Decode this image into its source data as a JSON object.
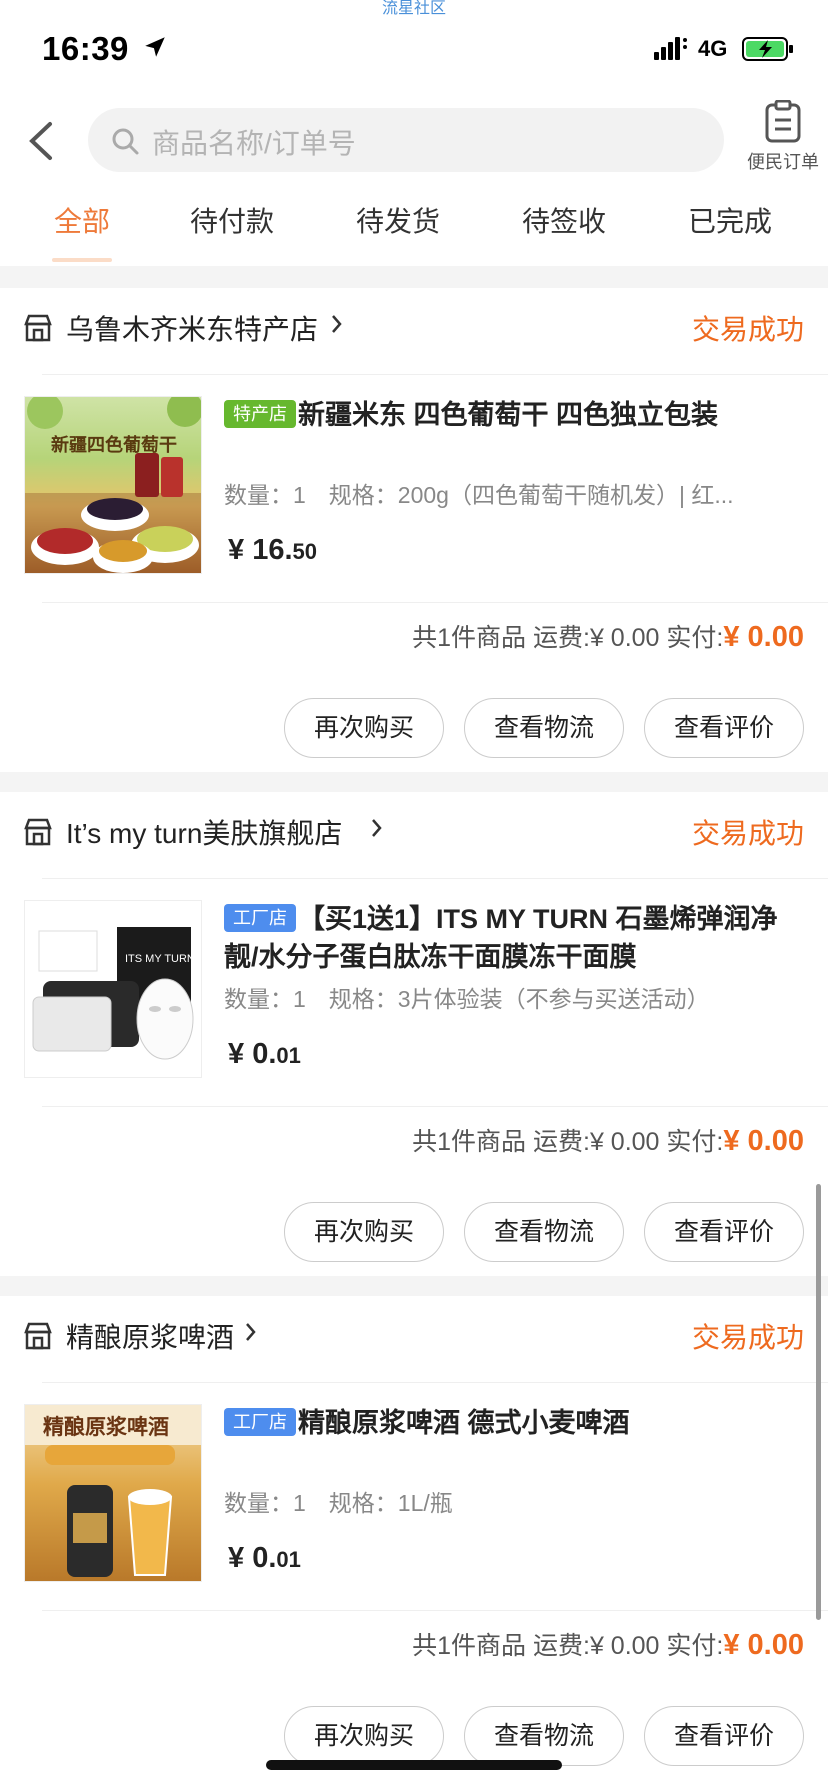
{
  "watermark": "流星社区",
  "status_bar": {
    "time": "16:39",
    "network": "4G"
  },
  "nav": {
    "search_placeholder": "商品名称/订单号",
    "order_label": "便民订单"
  },
  "tabs": [
    {
      "label": "全部",
      "active": true
    },
    {
      "label": "待付款"
    },
    {
      "label": "待发货"
    },
    {
      "label": "待签收"
    },
    {
      "label": "已完成"
    }
  ],
  "orders": [
    {
      "shop": "乌鲁木齐米东特产店",
      "status": "交易成功",
      "badge": "特产店",
      "title": "新疆米东 四色葡萄干 四色独立包装",
      "spec": "数量：1　规格：200g（四色葡萄干随机发）| 红...",
      "price_symbol": "¥",
      "price_int": "16.",
      "price_dec": "50",
      "summary": "共1件商品 运费:¥ 0.00 实付:",
      "paid": "¥ 0.00",
      "thumb_text": "新疆四色葡萄干"
    },
    {
      "shop": "It’s my turn美肤旗舰店",
      "status": "交易成功",
      "badge": "工厂店",
      "title": "【买1送1】ITS MY TURN 石墨烯弹润净靓/水分子蛋白肽冻干面膜冻干面膜",
      "spec": "数量：1　规格：3片体验装（不参与买送活动）",
      "price_symbol": "¥",
      "price_int": "0.",
      "price_dec": "01",
      "summary": "共1件商品 运费:¥ 0.00 实付:",
      "paid": "¥ 0.00",
      "thumb_text": "ITS MY TURN"
    },
    {
      "shop": "精酿原浆啤酒",
      "status": "交易成功",
      "badge": "工厂店",
      "title": "精酿原浆啤酒 德式小麦啤酒",
      "spec": "数量：1　规格：1L/瓶",
      "price_symbol": "¥",
      "price_int": "0.",
      "price_dec": "01",
      "summary": "共1件商品 运费:¥ 0.00 实付:",
      "paid": "¥ 0.00",
      "thumb_text": "精酿原浆啤酒"
    }
  ],
  "actions": {
    "rebuy": "再次购买",
    "logistics": "查看物流",
    "review": "查看评价"
  },
  "colors": {
    "accent": "#ee6a1f",
    "badge_green": "#66b82e",
    "badge_blue": "#4e8dee"
  }
}
